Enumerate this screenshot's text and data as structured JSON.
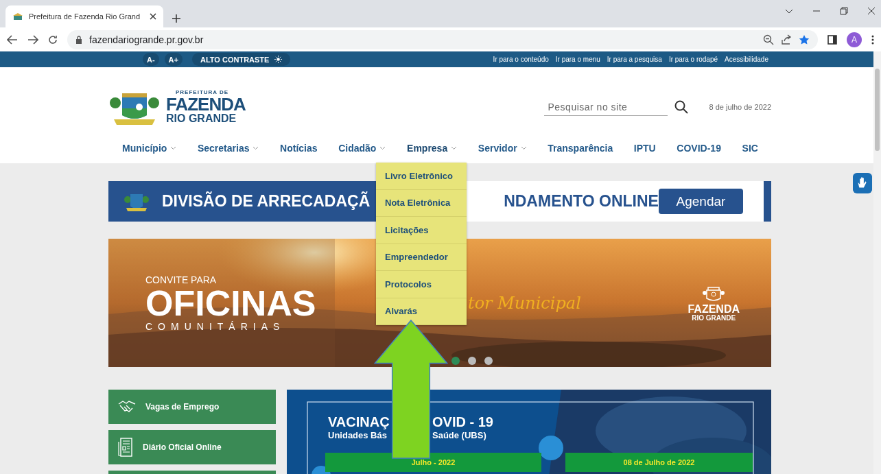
{
  "browser": {
    "tab_title": "Prefeitura de Fazenda Rio Grand",
    "url": "fazendariogrande.pr.gov.br",
    "profile": "A"
  },
  "topbar": {
    "font_buttons": [
      "A-",
      "A+"
    ],
    "contrast": "ALTO CONTRASTE",
    "links": [
      "Ir para o conteúdo",
      "Ir para o menu",
      "Ir para a pesquisa",
      "Ir para o rodapé",
      "Acessibilidade"
    ]
  },
  "header": {
    "logo": {
      "kicker": "PREFEITURA DE",
      "name": "FAZENDA",
      "subname": "RIO GRANDE"
    },
    "search": {
      "placeholder": "Pesquisar no site"
    },
    "date": "8 de julho de 2022"
  },
  "nav": [
    {
      "label": "Município",
      "has_dropdown": true,
      "expanded": false
    },
    {
      "label": "Secretarias",
      "has_dropdown": true,
      "expanded": false
    },
    {
      "label": "Notícias",
      "has_dropdown": false,
      "expanded": false
    },
    {
      "label": "Cidadão",
      "has_dropdown": true,
      "expanded": false
    },
    {
      "label": "Empresa",
      "has_dropdown": true,
      "expanded": true
    },
    {
      "label": "Servidor",
      "has_dropdown": true,
      "expanded": false
    },
    {
      "label": "Transparência",
      "has_dropdown": false,
      "expanded": false
    },
    {
      "label": "IPTU",
      "has_dropdown": false,
      "expanded": false
    },
    {
      "label": "COVID-19",
      "has_dropdown": false,
      "expanded": false
    },
    {
      "label": "SIC",
      "has_dropdown": false,
      "expanded": false
    }
  ],
  "dropdown": [
    "Livro Eletrônico",
    "Nota Eletrônica",
    "Licitações",
    "Empreendedor",
    "Protocolos",
    "Alvarás"
  ],
  "banner": {
    "text_left": "DIVISÃO DE ARRECADAÇÃ",
    "text_right": "NDAMENTO ONLINE",
    "button": "Agendar"
  },
  "hero": {
    "kind": "picture",
    "kicker": "CONVITE PARA",
    "title": "OFICINAS",
    "subtitle": "COMUNITÁRIAS",
    "script": "tor Municipal",
    "logo_name": "FAZENDA",
    "logo_subname": "RIO GRANDE",
    "dots": [
      {
        "selected": true
      },
      {
        "selected": false
      },
      {
        "selected": false
      }
    ]
  },
  "quick_links": [
    {
      "label": "Vagas de Emprego",
      "kind": "handshake"
    },
    {
      "label": "Diário Oficial Online",
      "kind": "newspaper"
    }
  ],
  "vaccine": {
    "kind": "picture",
    "title_left": "VACINAÇ",
    "title_right": "OVID - 19",
    "subtitle_left": "Unidades Bás",
    "subtitle_right": "Saúde (UBS)",
    "dates": [
      "Julho - 2022",
      "08 de Julho de 2022"
    ]
  }
}
